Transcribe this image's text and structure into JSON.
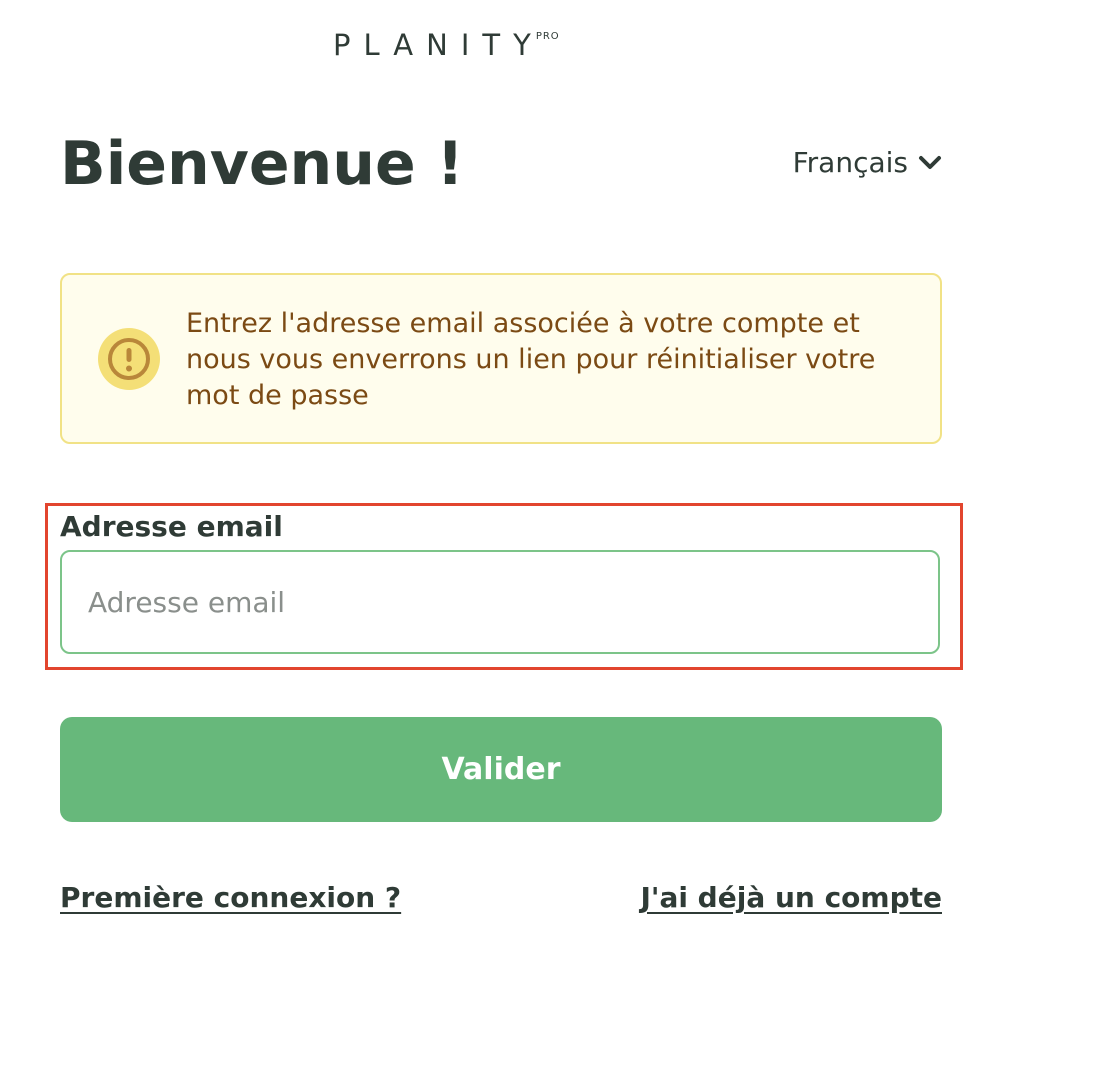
{
  "brand": {
    "logo_text": "PLANITY",
    "logo_badge": "PRO"
  },
  "header": {
    "title": "Bienvenue !",
    "language": "Français",
    "language_icon": "chevron-down-icon"
  },
  "notice": {
    "icon": "exclamation-circle-icon",
    "text": "Entrez l'adresse email associée à votre compte et nous vous enverrons un lien pour réinitialiser votre mot de passe"
  },
  "form": {
    "email_label": "Adresse email",
    "email_placeholder": "Adresse email",
    "email_value": "",
    "submit_label": "Valider"
  },
  "links": {
    "first_login": "Première connexion ?",
    "have_account": "J'ai déjà un compte"
  },
  "colors": {
    "text": "#2f3b36",
    "accent_green": "#67b87b",
    "input_border": "#7cc489",
    "notice_bg": "#fffded",
    "notice_border": "#f1e286",
    "notice_text": "#7b4a14",
    "highlight": "#e2452e"
  }
}
